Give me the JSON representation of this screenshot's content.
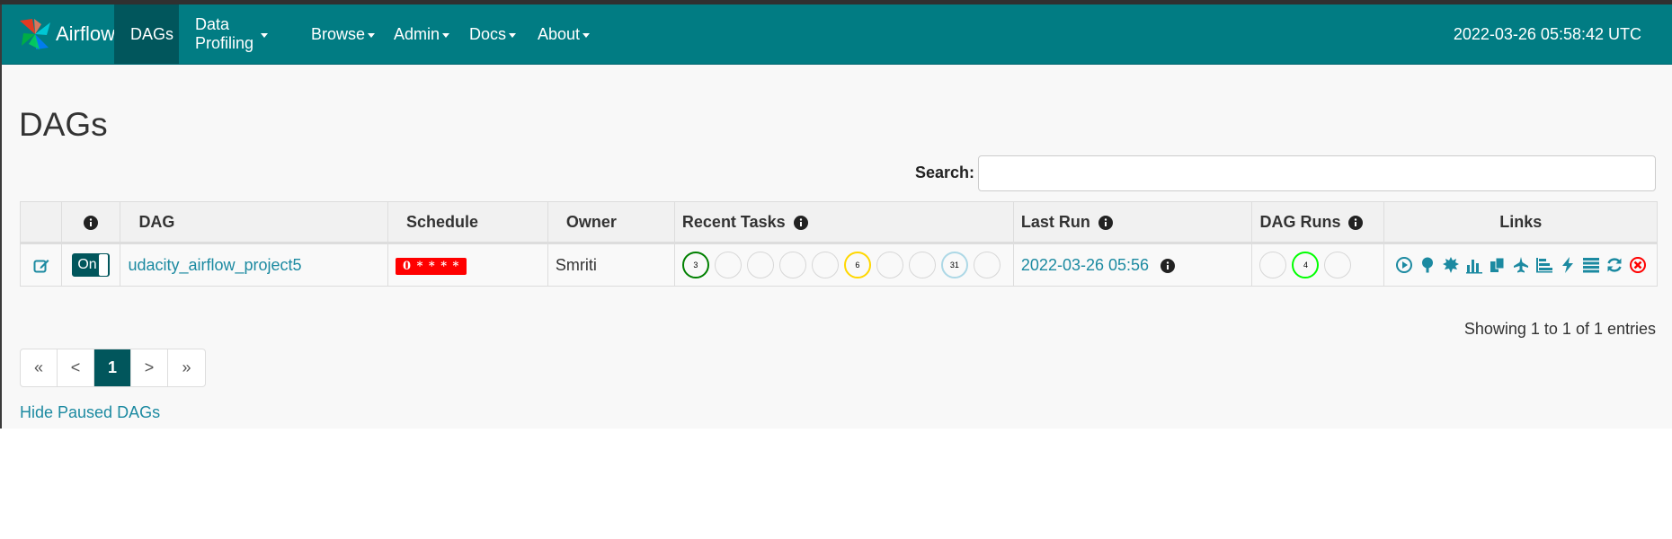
{
  "colors": {
    "navbar": "#017c83",
    "navbar_active": "#01565c",
    "link": "#1c8aa1",
    "success": "#008000",
    "running": "#00ff00",
    "upstream_failed": "#ffd700",
    "skipped": "#add8e6",
    "schedule_badge": "#ff0000",
    "link_icons": "#1c8aa1",
    "delete_icon": "#ff0000"
  },
  "navbar": {
    "brand": "Airflow",
    "items": [
      {
        "label": "DAGs",
        "active": true,
        "dropdown": false
      },
      {
        "label": "Data Profiling",
        "dropdown": true
      },
      {
        "label": "Browse",
        "dropdown": true
      },
      {
        "label": "Admin",
        "dropdown": true
      },
      {
        "label": "Docs",
        "dropdown": true
      },
      {
        "label": "About",
        "dropdown": true
      }
    ],
    "clock": "2022-03-26 05:58:42 UTC"
  },
  "page": {
    "title": "DAGs",
    "search_label": "Search:",
    "search_value": ""
  },
  "table": {
    "headers": {
      "info": "info-icon",
      "dag": "DAG",
      "schedule": "Schedule",
      "owner": "Owner",
      "recent_tasks": "Recent Tasks",
      "last_run": "Last Run",
      "dag_runs": "DAG Runs",
      "links": "Links"
    },
    "rows": [
      {
        "edit_icon": "edit-icon",
        "toggle": "On",
        "dag_id": "udacity_airflow_project5",
        "schedule": "0 * * * *",
        "owner": "Smriti",
        "recent_tasks": [
          {
            "state": "success",
            "count": "3"
          },
          {
            "state": "running",
            "count": ""
          },
          {
            "state": "failed",
            "count": ""
          },
          {
            "state": "up_for_retry",
            "count": ""
          },
          {
            "state": "queued",
            "count": ""
          },
          {
            "state": "upstream_failed",
            "count": "6"
          },
          {
            "state": "up_for_reschedule",
            "count": ""
          },
          {
            "state": "scheduled",
            "count": ""
          },
          {
            "state": "skipped",
            "count": "31"
          },
          {
            "state": "none",
            "count": ""
          }
        ],
        "last_run": "2022-03-26 05:56",
        "dag_runs": [
          {
            "state": "success",
            "count": ""
          },
          {
            "state": "running",
            "count": "4"
          },
          {
            "state": "failed",
            "count": ""
          }
        ],
        "links": [
          "trigger-dag-icon",
          "tree-view-icon",
          "graph-view-icon",
          "task-duration-icon",
          "task-tries-icon",
          "landing-times-icon",
          "gantt-icon",
          "code-icon",
          "logs-icon",
          "refresh-icon",
          "delete-icon"
        ]
      }
    ]
  },
  "footer": {
    "showing": "Showing 1 to 1 of 1 entries",
    "pager": [
      "«",
      "<",
      "1",
      ">",
      "»"
    ],
    "active_page": "1",
    "hide_paused": "Hide Paused DAGs"
  }
}
